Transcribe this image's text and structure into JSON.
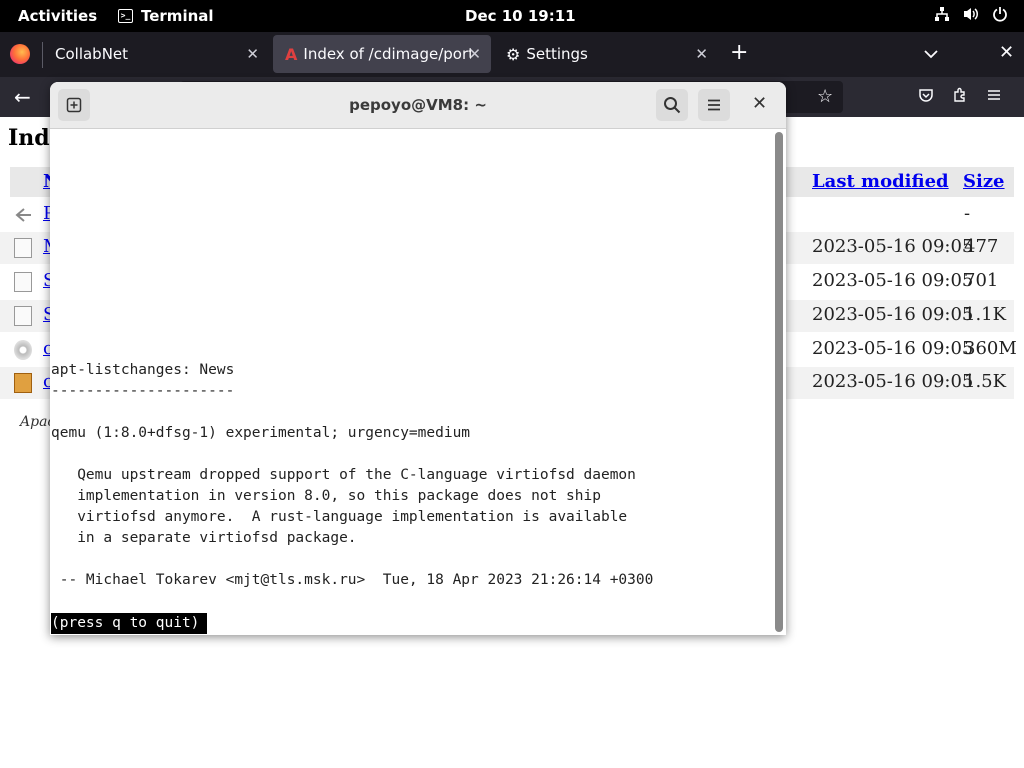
{
  "topbar": {
    "activities": "Activities",
    "app_name": "Terminal",
    "clock": "Dec 10  19:11"
  },
  "browser": {
    "tabs": [
      {
        "label": "CollabNet",
        "active": false
      },
      {
        "label": "Index of /cdimage/ports/",
        "active": true
      },
      {
        "label": "Settings",
        "active": false
      }
    ]
  },
  "page": {
    "title": "Inde",
    "columns": {
      "name": "N",
      "last_modified": "Last modified",
      "size": "Size"
    },
    "rows": [
      {
        "name": "P",
        "date": "",
        "size": "-",
        "icon": "back-icon"
      },
      {
        "name": "M",
        "date": "2023-05-16 09:05",
        "size": "477",
        "icon": "text-file-icon"
      },
      {
        "name": "S",
        "date": "2023-05-16 09:05",
        "size": "701",
        "icon": "text-file-icon"
      },
      {
        "name": "S",
        "date": "2023-05-16 09:05",
        "size": "1.1K",
        "icon": "text-file-icon"
      },
      {
        "name": "c",
        "date": "2023-05-16 09:05",
        "size": "360M",
        "icon": "disc-icon"
      },
      {
        "name": "c",
        "date": "2023-05-16 09:05",
        "size": "1.5K",
        "icon": "package-icon"
      }
    ],
    "footer": "Apac"
  },
  "terminal": {
    "title": "pepoyo@VM8: ~",
    "lines": [
      "apt-listchanges: News",
      "---------------------",
      "",
      "qemu (1:8.0+dfsg-1) experimental; urgency=medium",
      "",
      "   Qemu upstream dropped support of the C-language virtiofsd daemon",
      "   implementation in version 8.0, so this package does not ship",
      "   virtiofsd anymore.  A rust-language implementation is available",
      "   in a separate virtiofsd package.",
      "",
      " -- Michael Tokarev <mjt@tls.msk.ru>  Tue, 18 Apr 2023 21:26:14 +0300"
    ],
    "prompt": "(press q to quit)"
  }
}
